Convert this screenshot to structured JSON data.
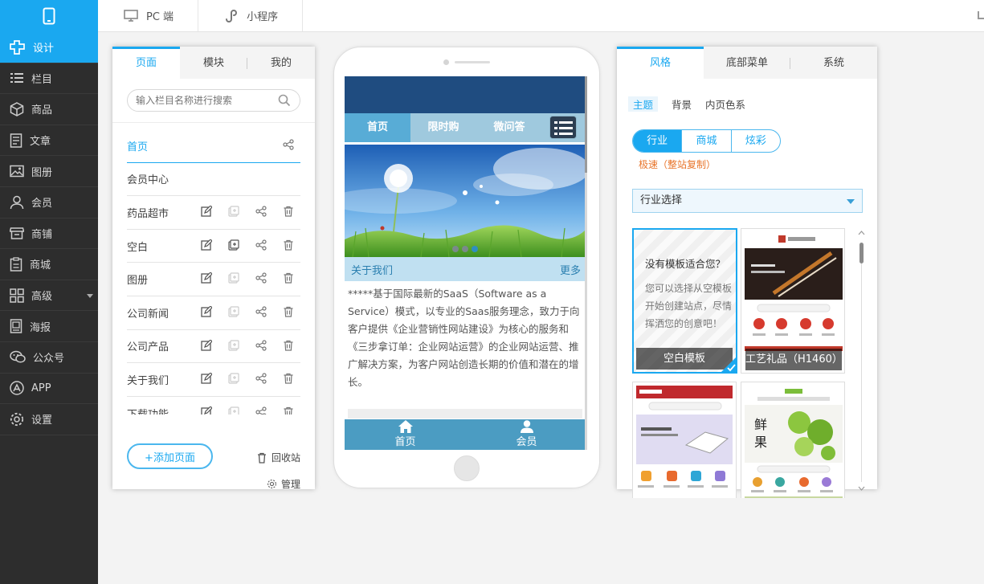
{
  "colors": {
    "accent": "#1aa8f0",
    "sidebar_bg": "#2d2d2d",
    "orange_note": "#e8742a"
  },
  "sidebar": {
    "items": [
      {
        "label": "设计",
        "icon": "design-icon",
        "active": true
      },
      {
        "label": "栏目",
        "icon": "list-icon"
      },
      {
        "label": "商品",
        "icon": "box-icon"
      },
      {
        "label": "文章",
        "icon": "article-icon"
      },
      {
        "label": "图册",
        "icon": "gallery-icon"
      },
      {
        "label": "会员",
        "icon": "user-icon"
      },
      {
        "label": "商铺",
        "icon": "shop-icon"
      },
      {
        "label": "商城",
        "icon": "mall-icon"
      },
      {
        "label": "高级",
        "icon": "grid-icon",
        "has_arrow": true
      },
      {
        "label": "海报",
        "icon": "poster-icon"
      },
      {
        "label": "公众号",
        "icon": "wechat-icon"
      },
      {
        "label": "APP",
        "icon": "app-icon"
      },
      {
        "label": "设置",
        "icon": "gear-icon"
      }
    ]
  },
  "topbar": {
    "tabs": [
      {
        "label": "PC 端",
        "icon": "monitor-icon"
      },
      {
        "label": "小程序",
        "icon": "mini-program-icon"
      }
    ]
  },
  "left_panel": {
    "tabs": [
      "页面",
      "模块",
      "我的"
    ],
    "search_placeholder": "输入栏目名称进行搜索",
    "pages": [
      "首页",
      "会员中心",
      "药品超市",
      "空白",
      "图册",
      "公司新闻",
      "公司产品",
      "关于我们",
      "下载功能"
    ],
    "add_button": "+添加页面",
    "recycle": "回收站",
    "manage": "管理"
  },
  "preview": {
    "nav": [
      "首页",
      "限时购",
      "微问答"
    ],
    "about_title": "关于我们",
    "about_more": "更多",
    "about_text": "*****基于国际最新的SaaS（Software as a Service）模式，以专业的Saas服务理念，致力于向客户提供《企业营销性网站建设》为核心的服务和《三步拿订单：企业网站运营》的企业网站运营、推广解决方案，为客户网站创造长期的价值和潜在的增长。",
    "footer": [
      {
        "label": "首页",
        "icon": "home-icon"
      },
      {
        "label": "会员",
        "icon": "member-icon"
      }
    ]
  },
  "right_panel": {
    "tabs": [
      "风格",
      "底部菜单",
      "系统"
    ],
    "sub_tabs": [
      "主题",
      "背景",
      "内页色系"
    ],
    "pills": [
      "行业",
      "商城",
      "炫彩"
    ],
    "speed_note": "极速（整站复制）",
    "industry_select": "行业选择",
    "blank_template": {
      "title": "没有模板适合您？",
      "desc": "您可以选择从空模板开始创建站点，尽情挥洒您的创意吧！",
      "label": "空白模板"
    },
    "templates": [
      {
        "label": "工艺礼品（H1460）"
      }
    ]
  }
}
